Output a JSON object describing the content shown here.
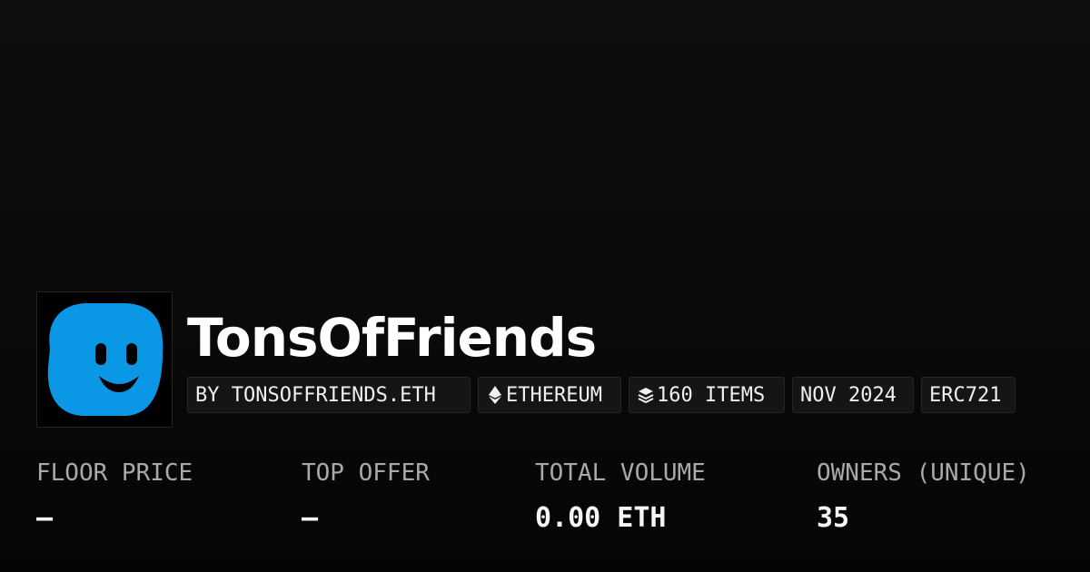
{
  "collection": {
    "name": "TonsOfFriends"
  },
  "tags": [
    {
      "label": "BY TONSOFFRIENDS.ETH",
      "icon": ""
    },
    {
      "label": "ETHEREUM",
      "icon": "ethereum-icon"
    },
    {
      "label": "160 ITEMS",
      "icon": "layers-icon"
    },
    {
      "label": "NOV 2024",
      "icon": ""
    },
    {
      "label": "ERC721",
      "icon": ""
    }
  ],
  "stats": [
    {
      "label": "FLOOR PRICE",
      "value": "–"
    },
    {
      "label": "TOP OFFER",
      "value": "–"
    },
    {
      "label": "TOTAL VOLUME",
      "value": "0.00 ETH"
    },
    {
      "label": "OWNERS (UNIQUE)",
      "value": "35"
    }
  ],
  "colors": {
    "background": "#0a0a0a",
    "avatar_face": "#0a97e6",
    "tag_background": "#151515",
    "label_gray": "#a9a9a9"
  }
}
